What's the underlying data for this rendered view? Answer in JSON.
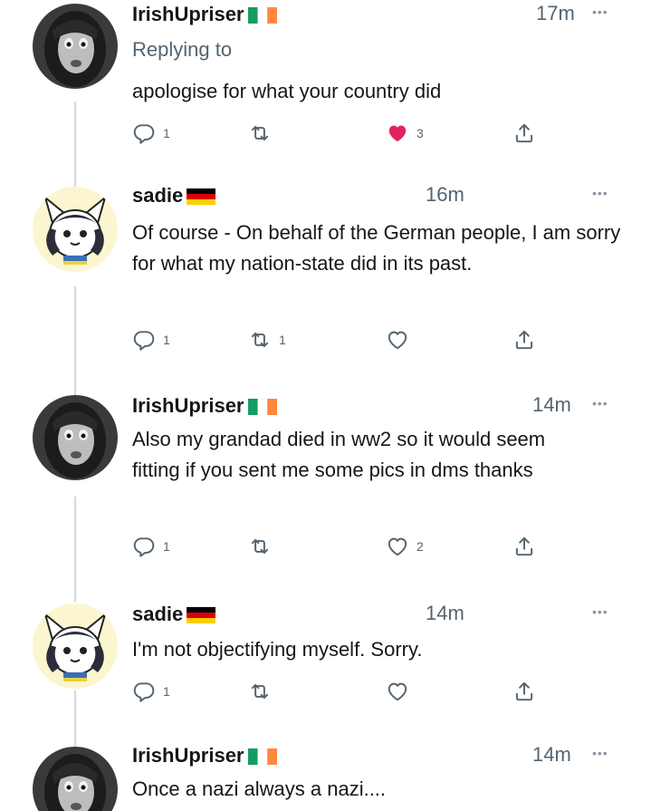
{
  "thread": [
    {
      "author": "IrishUpriser",
      "flag": "ireland",
      "time": "17m",
      "replying_to": "Replying to",
      "text": "apologise for what your country did",
      "actions": {
        "replies": "1",
        "retweets": "",
        "likes": "3",
        "liked": true
      }
    },
    {
      "author": "sadie",
      "flag": "germany",
      "time": "16m",
      "text": "Of course - On behalf of the German people, I am sorry for what my nation-state did in its past.",
      "actions": {
        "replies": "1",
        "retweets": "1",
        "likes": "",
        "liked": false
      }
    },
    {
      "author": "IrishUpriser",
      "flag": "ireland",
      "time": "14m",
      "text": "Also my grandad died in ww2 so it would seem fitting if you sent me some pics in dms thanks",
      "actions": {
        "replies": "1",
        "retweets": "",
        "likes": "2",
        "liked": false
      }
    },
    {
      "author": "sadie",
      "flag": "germany",
      "time": "14m",
      "text": "I'm not objectifying myself. Sorry.",
      "actions": {
        "replies": "1",
        "retweets": "",
        "likes": "",
        "liked": false
      }
    },
    {
      "author": "IrishUpriser",
      "flag": "ireland",
      "time": "14m",
      "text": "Once a nazi always a nazi...."
    }
  ],
  "colors": {
    "like_active": "#e0245e",
    "icon": "#536471",
    "line": "#cfd9de"
  }
}
